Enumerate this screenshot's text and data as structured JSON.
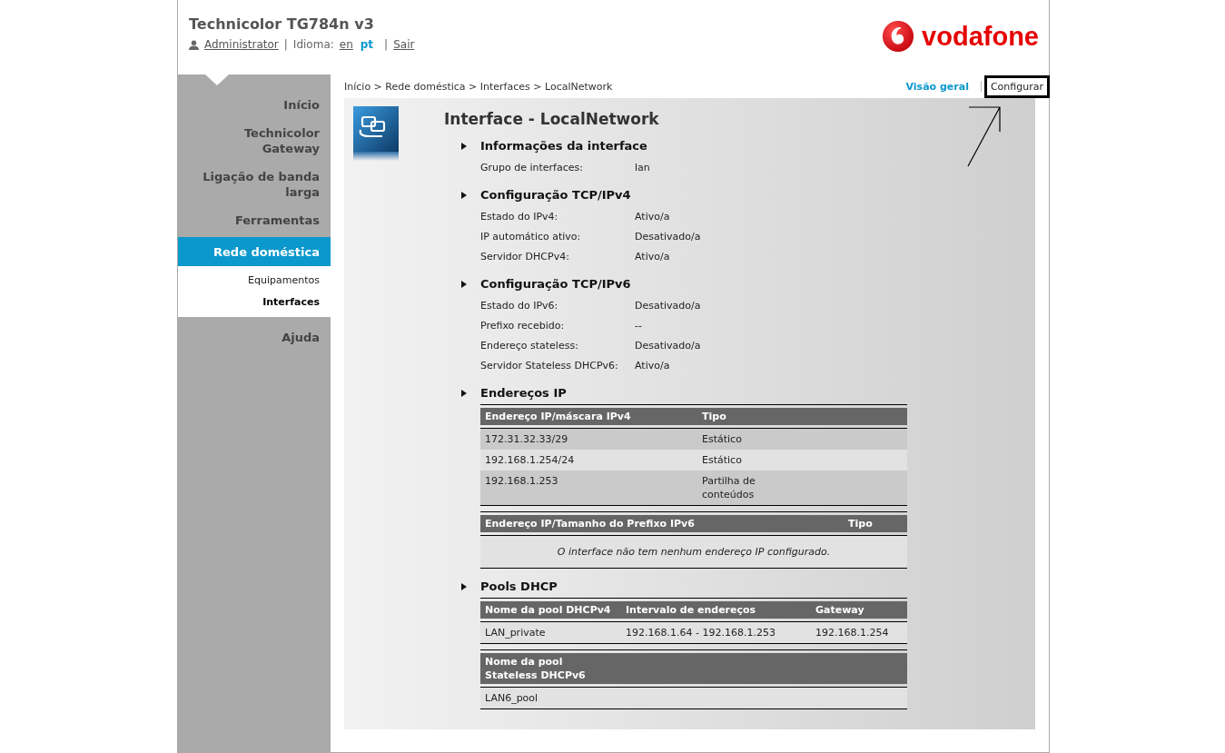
{
  "header": {
    "title": "Technicolor TG784n v3",
    "user": "Administrator",
    "language_label": "Idioma:",
    "languages": [
      {
        "label": "en",
        "selected": false
      },
      {
        "label": "pt",
        "selected": true
      }
    ],
    "logout": "Sair",
    "separators": [
      "|",
      "|"
    ],
    "logo_text": "vodafone"
  },
  "sidebar": {
    "items": [
      {
        "label": "Início",
        "selected": false
      },
      {
        "label": "Technicolor Gateway",
        "selected": false
      },
      {
        "label": "Ligação de banda larga",
        "selected": false
      },
      {
        "label": "Ferramentas",
        "selected": false
      },
      {
        "label": "Rede doméstica",
        "selected": true,
        "children": [
          {
            "label": "Equipamentos",
            "selected": false
          },
          {
            "label": "Interfaces",
            "selected": true
          }
        ]
      },
      {
        "label": "Ajuda",
        "selected": false
      }
    ]
  },
  "breadcrumb": "Início > Rede doméstica > Interfaces > LocalNetwork",
  "view_tabs": [
    {
      "label": "Visão geral",
      "selected": true,
      "highlighted": false
    },
    {
      "label": "Configurar",
      "selected": false,
      "highlighted": true
    }
  ],
  "page_title": "Interface - LocalNetwork",
  "sections": [
    {
      "title": "Informações da interface",
      "kind": "fields",
      "fields": [
        {
          "label": "Grupo de interfaces:",
          "value": "lan"
        }
      ]
    },
    {
      "title": "Configuração TCP/IPv4",
      "kind": "fields",
      "fields": [
        {
          "label": "Estado do IPv4:",
          "value": "Ativo/a"
        },
        {
          "label": "IP automático ativo:",
          "value": "Desativado/a"
        },
        {
          "label": "Servidor DHCPv4:",
          "value": "Ativo/a"
        }
      ]
    },
    {
      "title": "Configuração TCP/IPv6",
      "kind": "fields",
      "fields": [
        {
          "label": "Estado do IPv6:",
          "value": "Desativado/a"
        },
        {
          "label": "Prefixo recebido:",
          "value": "--"
        },
        {
          "label": "Endereço stateless:",
          "value": "Desativado/a"
        },
        {
          "label": "Servidor Stateless DHCPv6:",
          "value": "Ativo/a"
        }
      ]
    },
    {
      "title": "Endereços IP",
      "kind": "tables",
      "tables": [
        {
          "columns": [
            "Endereço IP/máscara IPv4",
            "Tipo"
          ],
          "rows": [
            [
              "172.31.32.33/29",
              "Estático"
            ],
            [
              "192.168.1.254/24",
              "Estático"
            ],
            [
              "192.168.1.253",
              "Partilha de conteúdos"
            ]
          ]
        },
        {
          "columns": [
            "Endereço IP/Tamanho do Prefixo IPv6",
            "Tipo"
          ],
          "empty_message": "O interface não tem nenhum endereço IP configurado."
        }
      ]
    },
    {
      "title": "Pools DHCP",
      "kind": "tables",
      "tables": [
        {
          "columns": [
            "Nome da pool DHCPv4",
            "Intervalo de endereços",
            "Gateway"
          ],
          "rows": [
            [
              "LAN_private",
              "192.168.1.64 - 192.168.1.253",
              "192.168.1.254"
            ]
          ]
        },
        {
          "columns": [
            "Nome da pool Stateless DHCPv6"
          ],
          "rows": [
            [
              "LAN6_pool"
            ]
          ]
        }
      ]
    }
  ]
}
